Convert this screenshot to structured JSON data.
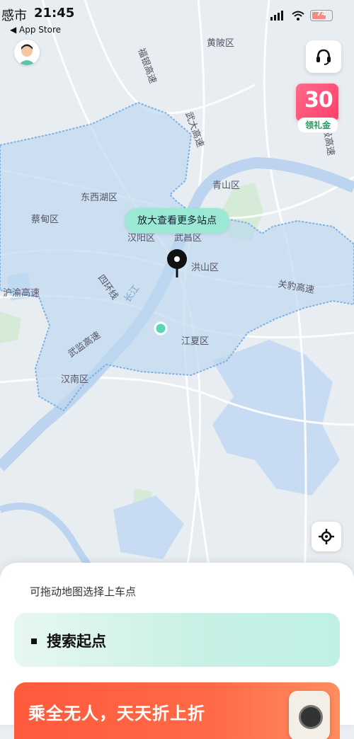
{
  "status_bar": {
    "left_text": "感市",
    "time": "21:45",
    "back_label": "◀ App Store",
    "battery": "74",
    "battery_level": 0.74
  },
  "map": {
    "labels": [
      {
        "key": "huangpo",
        "text": "黄陂区"
      },
      {
        "key": "fuyin",
        "text": "福银高速"
      },
      {
        "key": "wuda",
        "text": "武大高速"
      },
      {
        "key": "qingshan",
        "text": "青山区"
      },
      {
        "key": "dongxihu",
        "text": "东西湖区"
      },
      {
        "key": "caidian",
        "text": "蔡甸区"
      },
      {
        "key": "hanyang",
        "text": "汉阳区"
      },
      {
        "key": "wuchang",
        "text": "武昌区"
      },
      {
        "key": "hongshan",
        "text": "洪山区"
      },
      {
        "key": "huyu",
        "text": "沪渝高速"
      },
      {
        "key": "sihuan",
        "text": "四环线"
      },
      {
        "key": "changjiang",
        "text": "长江"
      },
      {
        "key": "guanbao",
        "text": "关豹高速"
      },
      {
        "key": "wujian",
        "text": "武监高速"
      },
      {
        "key": "jiangxia",
        "text": "江夏区"
      },
      {
        "key": "hannan",
        "text": "汉南区"
      },
      {
        "key": "gaosu_right",
        "text": "级高速"
      }
    ]
  },
  "map_tooltip": "放大查看更多站点",
  "gift": {
    "number": "30",
    "label": "领礼金"
  },
  "bottom_sheet": {
    "hint": "可拖动地图选择上车点",
    "search_label": "搜索起点",
    "promo_text": "乘全无人，天天折上折"
  },
  "colors": {
    "accent": "#5ad6b8",
    "service_area_fill": "#bcd7ef",
    "service_area_border": "#7fb1e0",
    "promo": "#ff5a3c"
  }
}
